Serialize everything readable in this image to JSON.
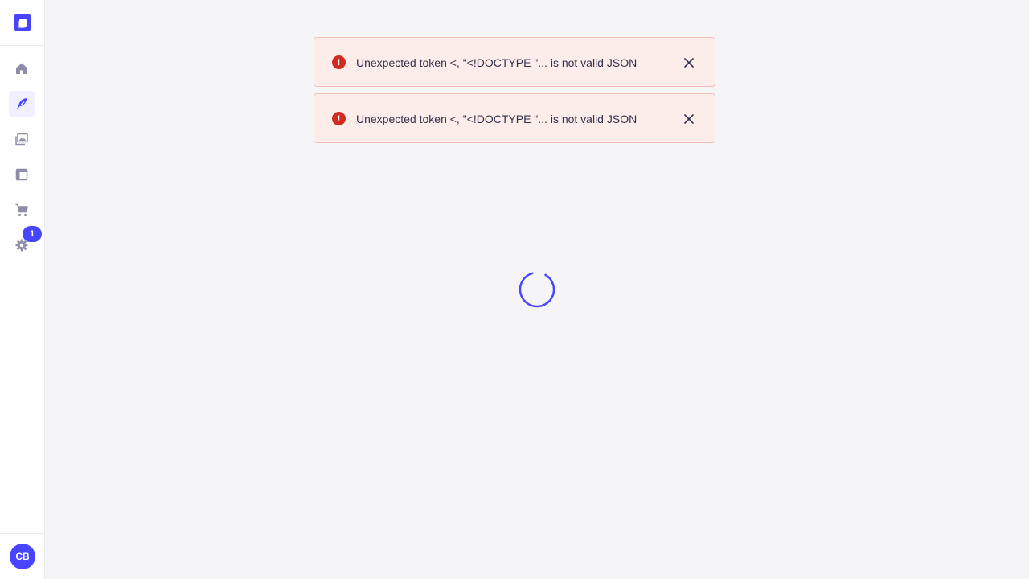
{
  "sidebar": {
    "logo_icon": "strapi-logo-icon",
    "nav_items": [
      {
        "icon": "home-icon"
      },
      {
        "icon": "content-manager-icon",
        "active": true
      },
      {
        "icon": "media-library-icon"
      },
      {
        "icon": "layout-icon"
      },
      {
        "icon": "cart-icon"
      },
      {
        "icon": "settings-icon",
        "badge": "1"
      }
    ],
    "avatar_initials": "CB"
  },
  "toasts": [
    {
      "message": "Unexpected token <, \"<!DOCTYPE \"... is not valid JSON",
      "icon": "error-icon"
    },
    {
      "message": "Unexpected token <, \"<!DOCTYPE \"... is not valid JSON",
      "icon": "error-icon"
    }
  ],
  "colors": {
    "accent": "#4945ff",
    "error": "#d02b20",
    "toast_bg": "#fcecea"
  }
}
